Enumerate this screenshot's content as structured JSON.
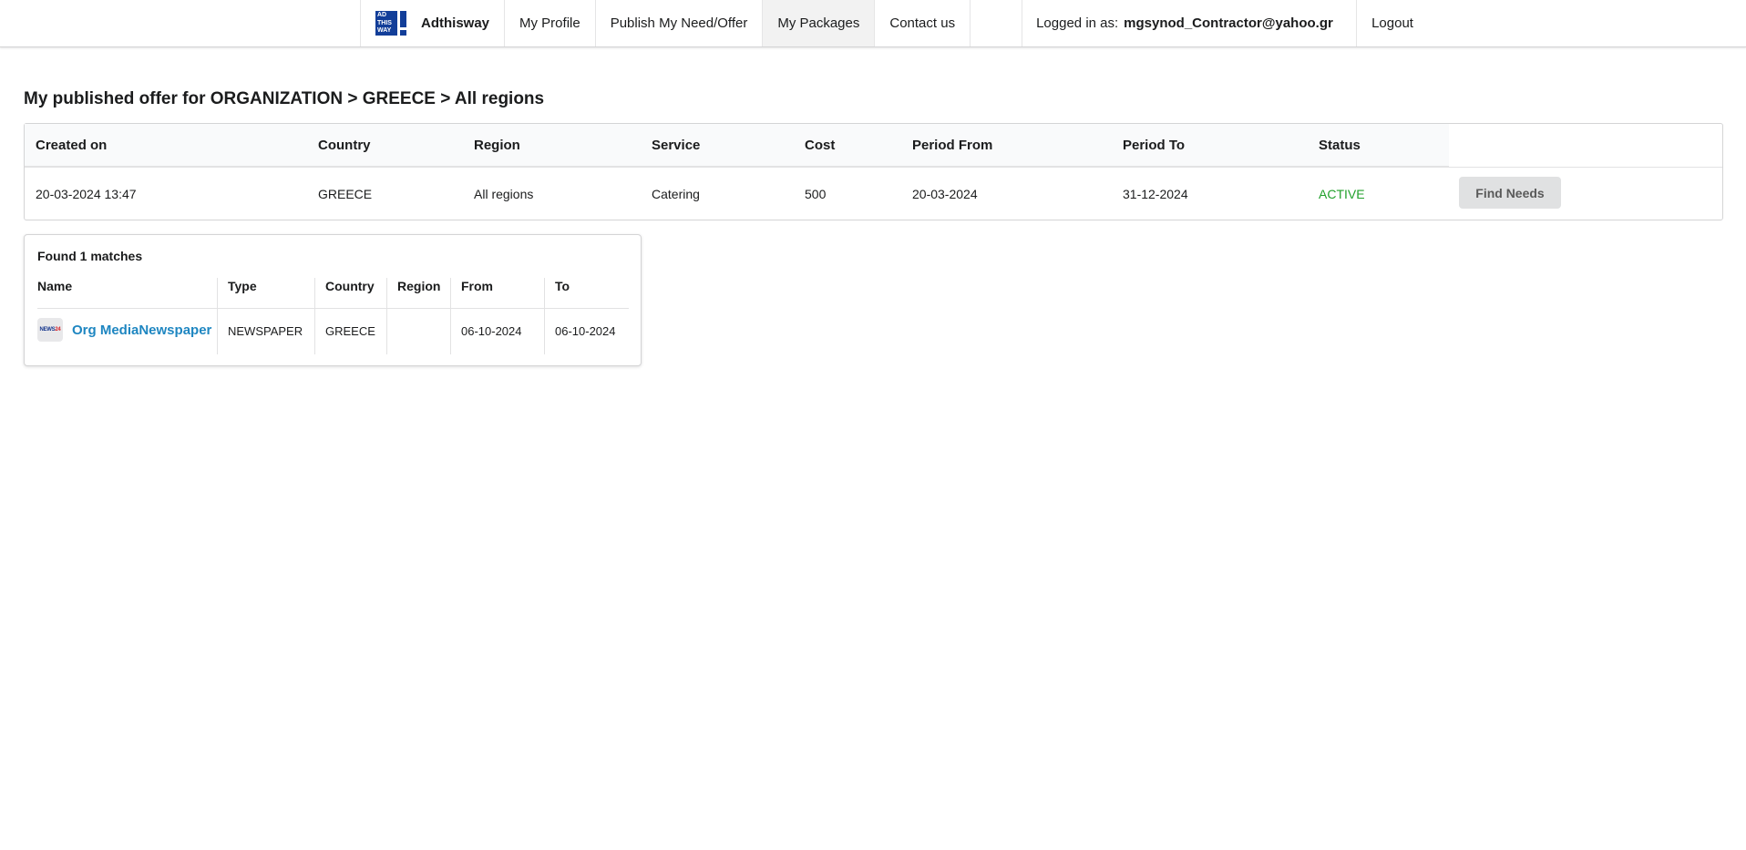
{
  "nav": {
    "logo_text": "AD THIS WAY",
    "brand": "Adthisway",
    "items": [
      {
        "label": "My Profile"
      },
      {
        "label": "Publish My Need/Offer"
      },
      {
        "label": "My Packages"
      },
      {
        "label": "Contact us"
      }
    ],
    "active_item": "My Packages",
    "logged_in_label": "Logged in as:",
    "logged_in_user": "mgsynod_Contractor@yahoo.gr",
    "logout": "Logout"
  },
  "page": {
    "title": "My published offer for ORGANIZATION > GREECE > All regions"
  },
  "offer_table": {
    "columns": [
      "Created on",
      "Country",
      "Region",
      "Service",
      "Cost",
      "Period From",
      "Period To",
      "Status"
    ],
    "row": {
      "created_on": "20-03-2024 13:47",
      "country": "GREECE",
      "region": "All regions",
      "service": "Catering",
      "cost": "500",
      "period_from": "20-03-2024",
      "period_to": "31-12-2024",
      "status": "ACTIVE"
    },
    "status_color": "#21a02b",
    "action_label": "Find Needs"
  },
  "matches": {
    "title": "Found 1 matches",
    "columns": [
      "Name",
      "Type",
      "Country",
      "Region",
      "From",
      "To"
    ],
    "rows": [
      {
        "thumb_text": "NEWS24",
        "name": "Org MediaNewspaper",
        "type": "NEWSPAPER",
        "country": "GREECE",
        "region": "",
        "from": "06-10-2024",
        "to": "06-10-2024"
      }
    ],
    "link_color": "#1e86c1"
  }
}
